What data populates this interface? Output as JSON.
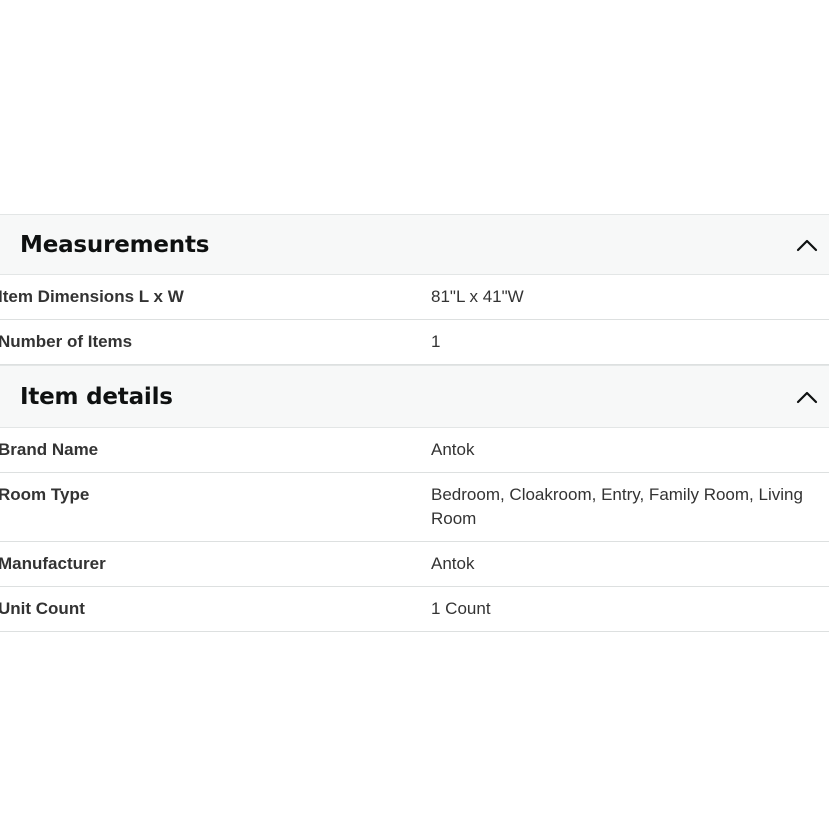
{
  "sections": [
    {
      "title": "Measurements",
      "toggle_icon": "chevron-up-icon",
      "rows": [
        {
          "label": "Item Dimensions L x W",
          "value": "81\"L x 41\"W"
        },
        {
          "label": "Number of Items",
          "value": "1"
        }
      ]
    },
    {
      "title": "Item details",
      "toggle_icon": "chevron-up-icon",
      "rows": [
        {
          "label": "Brand Name",
          "value": "Antok"
        },
        {
          "label": "Room Type",
          "value": "Bedroom, Cloakroom, Entry, Family Room, Living Room"
        },
        {
          "label": "Manufacturer",
          "value": "Antok"
        },
        {
          "label": "Unit Count",
          "value": "1 Count"
        }
      ]
    }
  ],
  "colors": {
    "header_background": "#f7f8f8",
    "divider": "#dde0e0",
    "text": "#333333",
    "title_text": "#0f1111"
  }
}
